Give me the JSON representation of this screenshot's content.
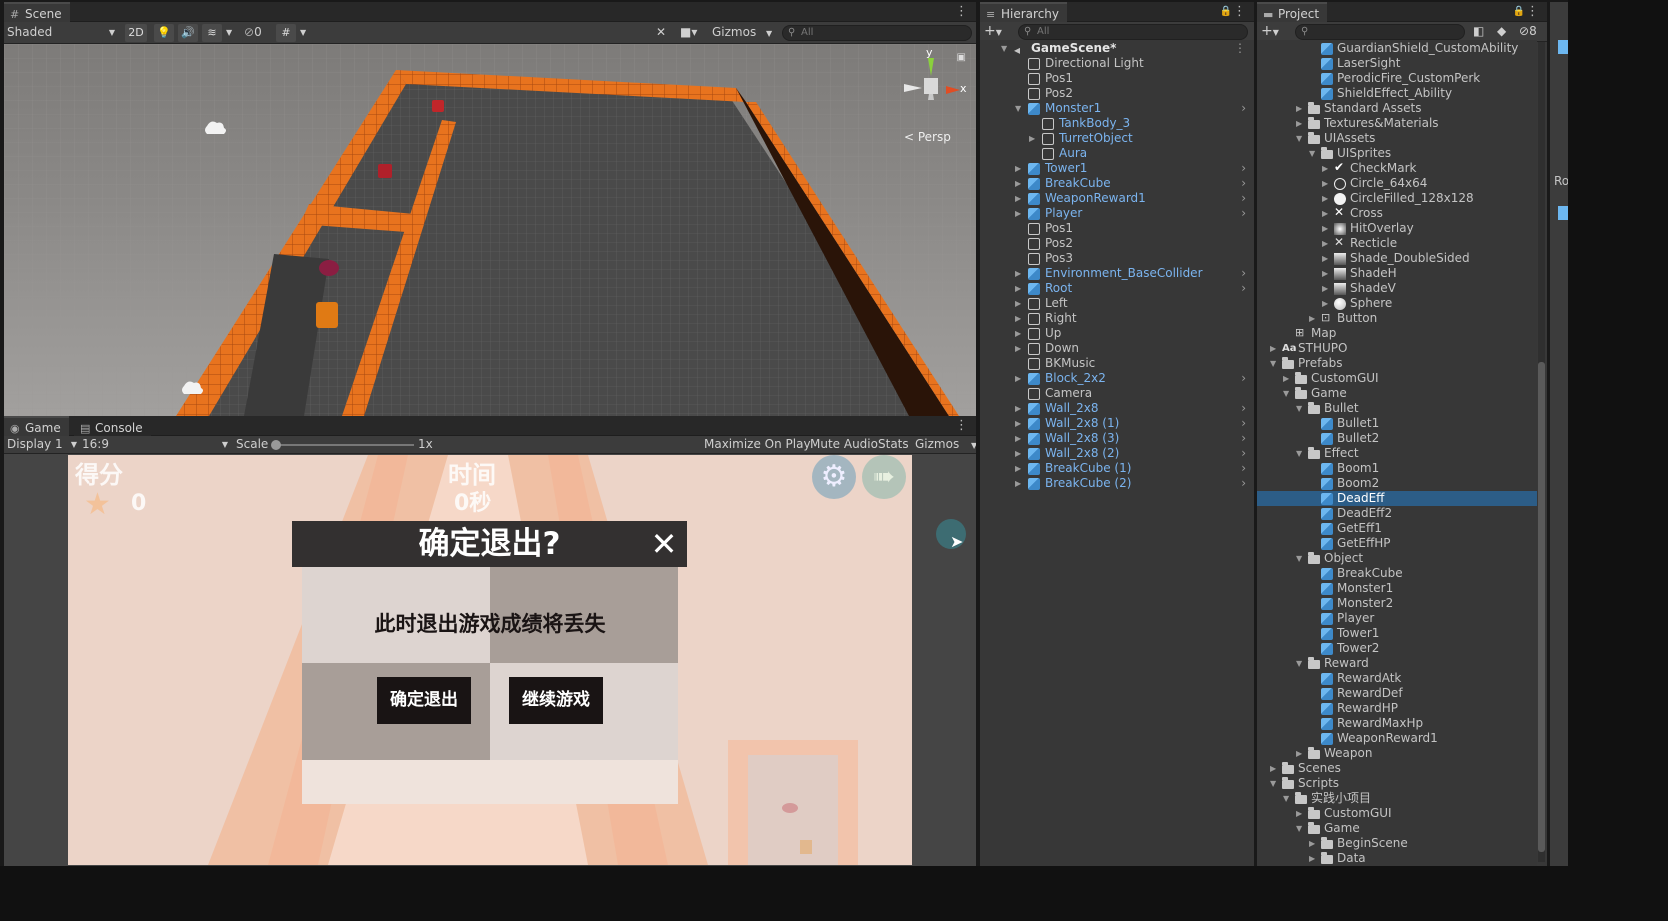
{
  "scene": {
    "tab": "Scene",
    "shading": "Shaded",
    "btn_2d": "2D",
    "hidden_count": "0",
    "gizmos": "Gizmos",
    "search_placeholder": "All",
    "persp": "< Persp",
    "axis_y": "y",
    "axis_x": "x"
  },
  "game": {
    "tabs": [
      "Game",
      "Console"
    ],
    "display": "Display 1",
    "aspect": "16:9",
    "scale_label": "Scale",
    "scale_value": "1x",
    "maximize": "Maximize On Play",
    "mute": "Mute Audio",
    "stats": "Stats",
    "gizmos": "Gizmos",
    "score_label": "得分",
    "score_value": "0",
    "time_label": "时间",
    "time_value": "0秒",
    "dialog_title": "确定退出?",
    "dialog_close": "✕",
    "dialog_message": "此时退出游戏成绩将丢失",
    "confirm_button": "确定退出",
    "continue_button": "继续游戏"
  },
  "hierarchy": {
    "tab": "Hierarchy",
    "search_placeholder": "All",
    "items": [
      {
        "label": "GameScene*",
        "indent": 0,
        "arrow": "down",
        "icon": "scene-icon",
        "blue": false,
        "chev": false,
        "bold": true
      },
      {
        "label": "Directional Light",
        "indent": 1,
        "arrow": "",
        "icon": "empty",
        "blue": false,
        "chev": false
      },
      {
        "label": "Pos1",
        "indent": 1,
        "arrow": "",
        "icon": "empty",
        "blue": false,
        "chev": false
      },
      {
        "label": "Pos2",
        "indent": 1,
        "arrow": "",
        "icon": "empty",
        "blue": false,
        "chev": false
      },
      {
        "label": "Monster1",
        "indent": 1,
        "arrow": "down",
        "icon": "cube",
        "blue": true,
        "chev": true
      },
      {
        "label": "TankBody_3",
        "indent": 2,
        "arrow": "",
        "icon": "empty",
        "blue": true,
        "chev": false
      },
      {
        "label": "TurretObject",
        "indent": 2,
        "arrow": "right",
        "icon": "empty",
        "blue": true,
        "chev": false
      },
      {
        "label": "Aura",
        "indent": 2,
        "arrow": "",
        "icon": "empty",
        "blue": true,
        "chev": false
      },
      {
        "label": "Tower1",
        "indent": 1,
        "arrow": "right",
        "icon": "cube",
        "blue": true,
        "chev": true
      },
      {
        "label": "BreakCube",
        "indent": 1,
        "arrow": "right",
        "icon": "cube",
        "blue": true,
        "chev": true
      },
      {
        "label": "WeaponReward1",
        "indent": 1,
        "arrow": "right",
        "icon": "cube",
        "blue": true,
        "chev": true
      },
      {
        "label": "Player",
        "indent": 1,
        "arrow": "right",
        "icon": "cube",
        "blue": true,
        "chev": true
      },
      {
        "label": "Pos1",
        "indent": 1,
        "arrow": "",
        "icon": "empty",
        "blue": false,
        "chev": false
      },
      {
        "label": "Pos2",
        "indent": 1,
        "arrow": "",
        "icon": "empty",
        "blue": false,
        "chev": false
      },
      {
        "label": "Pos3",
        "indent": 1,
        "arrow": "",
        "icon": "empty",
        "blue": false,
        "chev": false
      },
      {
        "label": "Environment_BaseCollider",
        "indent": 1,
        "arrow": "right",
        "icon": "cube",
        "blue": true,
        "chev": true
      },
      {
        "label": "Root",
        "indent": 1,
        "arrow": "right",
        "icon": "cube",
        "blue": true,
        "chev": true
      },
      {
        "label": "Left",
        "indent": 1,
        "arrow": "right",
        "icon": "empty",
        "blue": false,
        "chev": false
      },
      {
        "label": "Right",
        "indent": 1,
        "arrow": "right",
        "icon": "empty",
        "blue": false,
        "chev": false
      },
      {
        "label": "Up",
        "indent": 1,
        "arrow": "right",
        "icon": "empty",
        "blue": false,
        "chev": false
      },
      {
        "label": "Down",
        "indent": 1,
        "arrow": "right",
        "icon": "empty",
        "blue": false,
        "chev": false
      },
      {
        "label": "BKMusic",
        "indent": 1,
        "arrow": "",
        "icon": "empty",
        "blue": false,
        "chev": false
      },
      {
        "label": "Block_2x2",
        "indent": 1,
        "arrow": "right",
        "icon": "cube",
        "blue": true,
        "chev": true
      },
      {
        "label": "Camera",
        "indent": 1,
        "arrow": "",
        "icon": "empty",
        "blue": false,
        "chev": false
      },
      {
        "label": "Wall_2x8",
        "indent": 1,
        "arrow": "right",
        "icon": "cube",
        "blue": true,
        "chev": true
      },
      {
        "label": "Wall_2x8 (1)",
        "indent": 1,
        "arrow": "right",
        "icon": "cube",
        "blue": true,
        "chev": true
      },
      {
        "label": "Wall_2x8 (3)",
        "indent": 1,
        "arrow": "right",
        "icon": "cube",
        "blue": true,
        "chev": true
      },
      {
        "label": "Wall_2x8 (2)",
        "indent": 1,
        "arrow": "right",
        "icon": "cube",
        "blue": true,
        "chev": true
      },
      {
        "label": "BreakCube (1)",
        "indent": 1,
        "arrow": "right",
        "icon": "cube",
        "blue": true,
        "chev": true
      },
      {
        "label": "BreakCube (2)",
        "indent": 1,
        "arrow": "right",
        "icon": "cube",
        "blue": true,
        "chev": true
      }
    ]
  },
  "project": {
    "tab": "Project",
    "hidden_count": "8",
    "items": [
      {
        "label": "GuardianShield_CustomAbility",
        "indent": 4,
        "arrow": "",
        "icon": "cube"
      },
      {
        "label": "LaserSight",
        "indent": 4,
        "arrow": "",
        "icon": "cube"
      },
      {
        "label": "PerodicFire_CustomPerk",
        "indent": 4,
        "arrow": "",
        "icon": "cube"
      },
      {
        "label": "ShieldEffect_Ability",
        "indent": 4,
        "arrow": "",
        "icon": "cube"
      },
      {
        "label": "Standard Assets",
        "indent": 3,
        "arrow": "right",
        "icon": "folder"
      },
      {
        "label": "Textures&Materials",
        "indent": 3,
        "arrow": "right",
        "icon": "folder"
      },
      {
        "label": "UIAssets",
        "indent": 3,
        "arrow": "down",
        "icon": "folder"
      },
      {
        "label": "UISprites",
        "indent": 4,
        "arrow": "down",
        "icon": "folder"
      },
      {
        "label": "CheckMark",
        "indent": 5,
        "arrow": "right",
        "icon": "check"
      },
      {
        "label": "Circle_64x64",
        "indent": 5,
        "arrow": "right",
        "icon": "circle"
      },
      {
        "label": "CircleFilled_128x128",
        "indent": 5,
        "arrow": "right",
        "icon": "circle-filled"
      },
      {
        "label": "Cross",
        "indent": 5,
        "arrow": "right",
        "icon": "cross"
      },
      {
        "label": "HitOverlay",
        "indent": 5,
        "arrow": "right",
        "icon": "overlay"
      },
      {
        "label": "Recticle",
        "indent": 5,
        "arrow": "right",
        "icon": "recticle"
      },
      {
        "label": "Shade_DoubleSided",
        "indent": 5,
        "arrow": "right",
        "icon": "shade"
      },
      {
        "label": "ShadeH",
        "indent": 5,
        "arrow": "right",
        "icon": "shade"
      },
      {
        "label": "ShadeV",
        "indent": 5,
        "arrow": "right",
        "icon": "shade"
      },
      {
        "label": "Sphere",
        "indent": 5,
        "arrow": "right",
        "icon": "sphere"
      },
      {
        "label": "Button",
        "indent": 4,
        "arrow": "right",
        "icon": "button"
      },
      {
        "label": "Map",
        "indent": 2,
        "arrow": "",
        "icon": "map"
      },
      {
        "label": "STHUPO",
        "indent": 1,
        "arrow": "right",
        "icon": "font"
      },
      {
        "label": "Prefabs",
        "indent": 1,
        "arrow": "down",
        "icon": "folder"
      },
      {
        "label": "CustomGUI",
        "indent": 2,
        "arrow": "right",
        "icon": "folder"
      },
      {
        "label": "Game",
        "indent": 2,
        "arrow": "down",
        "icon": "folder"
      },
      {
        "label": "Bullet",
        "indent": 3,
        "arrow": "down",
        "icon": "folder"
      },
      {
        "label": "Bullet1",
        "indent": 4,
        "arrow": "",
        "icon": "cube"
      },
      {
        "label": "Bullet2",
        "indent": 4,
        "arrow": "",
        "icon": "cube"
      },
      {
        "label": "Effect",
        "indent": 3,
        "arrow": "down",
        "icon": "folder"
      },
      {
        "label": "Boom1",
        "indent": 4,
        "arrow": "",
        "icon": "cube"
      },
      {
        "label": "Boom2",
        "indent": 4,
        "arrow": "",
        "icon": "cube"
      },
      {
        "label": "DeadEff",
        "indent": 4,
        "arrow": "",
        "icon": "cube",
        "selected": true
      },
      {
        "label": "DeadEff2",
        "indent": 4,
        "arrow": "",
        "icon": "cube"
      },
      {
        "label": "GetEff1",
        "indent": 4,
        "arrow": "",
        "icon": "cube"
      },
      {
        "label": "GetEffHP",
        "indent": 4,
        "arrow": "",
        "icon": "cube"
      },
      {
        "label": "Object",
        "indent": 3,
        "arrow": "down",
        "icon": "folder"
      },
      {
        "label": "BreakCube",
        "indent": 4,
        "arrow": "",
        "icon": "cube"
      },
      {
        "label": "Monster1",
        "indent": 4,
        "arrow": "",
        "icon": "cube"
      },
      {
        "label": "Monster2",
        "indent": 4,
        "arrow": "",
        "icon": "cube"
      },
      {
        "label": "Player",
        "indent": 4,
        "arrow": "",
        "icon": "cube"
      },
      {
        "label": "Tower1",
        "indent": 4,
        "arrow": "",
        "icon": "cube"
      },
      {
        "label": "Tower2",
        "indent": 4,
        "arrow": "",
        "icon": "cube"
      },
      {
        "label": "Reward",
        "indent": 3,
        "arrow": "down",
        "icon": "folder"
      },
      {
        "label": "RewardAtk",
        "indent": 4,
        "arrow": "",
        "icon": "cube"
      },
      {
        "label": "RewardDef",
        "indent": 4,
        "arrow": "",
        "icon": "cube"
      },
      {
        "label": "RewardHP",
        "indent": 4,
        "arrow": "",
        "icon": "cube"
      },
      {
        "label": "RewardMaxHp",
        "indent": 4,
        "arrow": "",
        "icon": "cube"
      },
      {
        "label": "WeaponReward1",
        "indent": 4,
        "arrow": "",
        "icon": "cube"
      },
      {
        "label": "Weapon",
        "indent": 3,
        "arrow": "right",
        "icon": "folder"
      },
      {
        "label": "Scenes",
        "indent": 1,
        "arrow": "right",
        "icon": "folder"
      },
      {
        "label": "Scripts",
        "indent": 1,
        "arrow": "down",
        "icon": "folder"
      },
      {
        "label": "实践小项目",
        "indent": 2,
        "arrow": "down",
        "icon": "folder"
      },
      {
        "label": "CustomGUI",
        "indent": 3,
        "arrow": "right",
        "icon": "folder"
      },
      {
        "label": "Game",
        "indent": 3,
        "arrow": "down",
        "icon": "folder"
      },
      {
        "label": "BeginScene",
        "indent": 4,
        "arrow": "right",
        "icon": "folder"
      },
      {
        "label": "Data",
        "indent": 4,
        "arrow": "right",
        "icon": "folder"
      }
    ]
  },
  "inspector": {
    "partial_label": "Ro"
  },
  "colors": {
    "selection": "#2c5d87",
    "prefab_text": "#7bb4ef",
    "wall_orange": "#e8731e"
  }
}
